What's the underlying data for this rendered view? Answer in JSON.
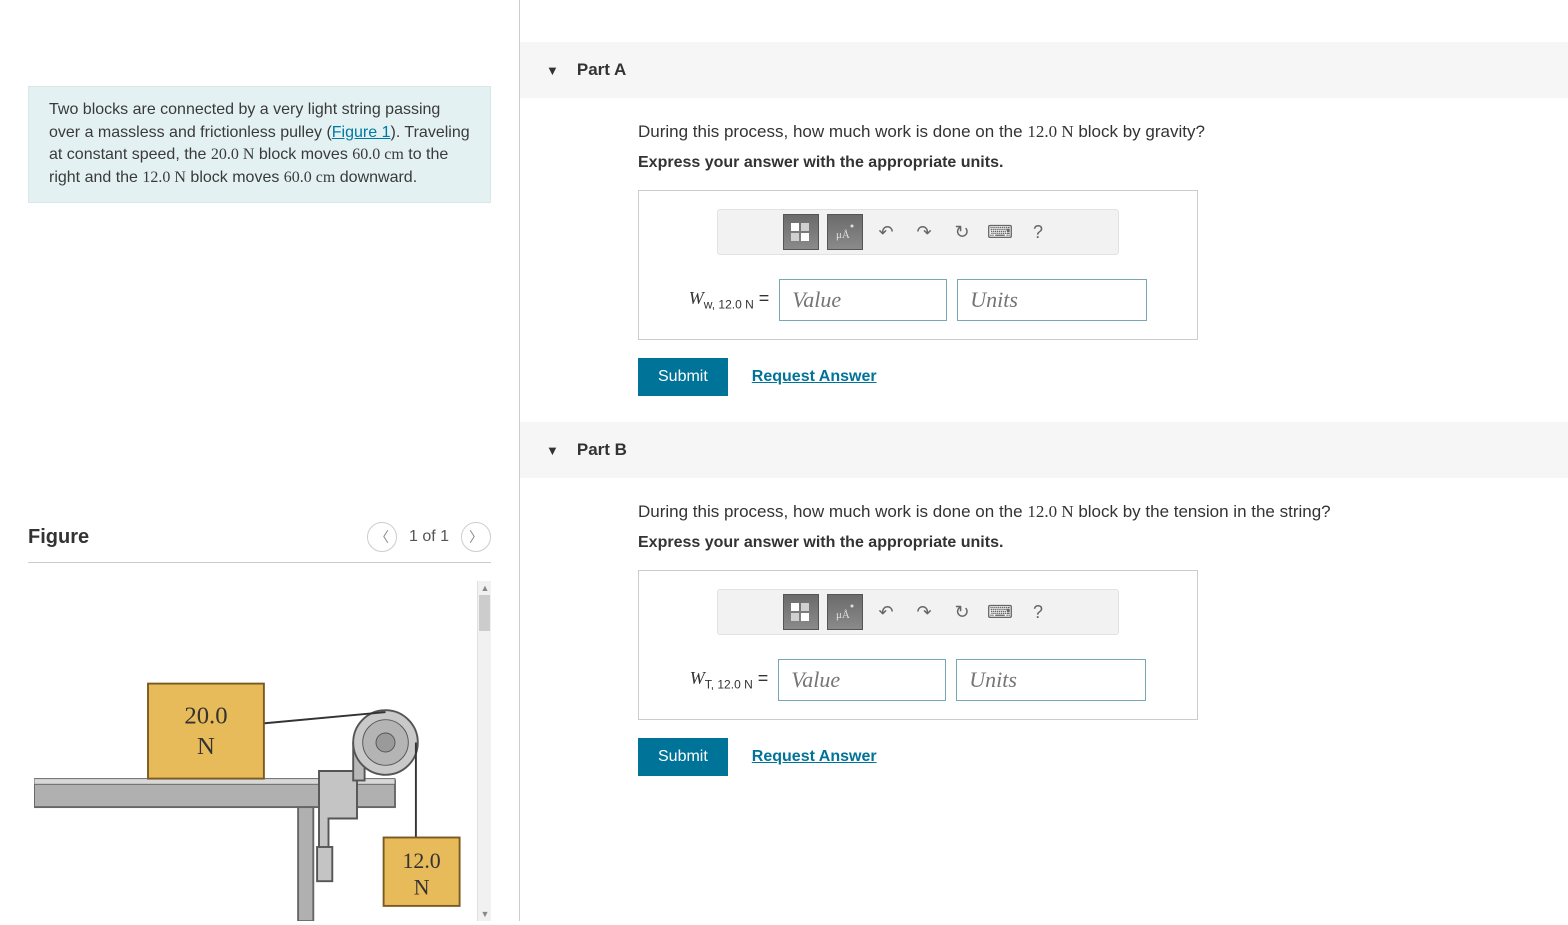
{
  "problem": {
    "text_pre": "Two blocks are connected by a very light string passing over a massless and frictionless pulley (",
    "fig_link": "Figure 1",
    "text_mid1": "). Traveling at constant speed, the ",
    "val_block1": "20.0 N",
    "text_mid2": " block moves ",
    "val_dist1": "60.0 cm",
    "text_mid3": " to the right and the ",
    "val_block2": "12.0 N",
    "text_mid4": " block moves ",
    "val_dist2": "60.0 cm",
    "text_end": " downward."
  },
  "figure": {
    "title": "Figure",
    "nav_label": "1 of 1",
    "block1_label": "20.0\nN",
    "block2_label": "12.0\nN"
  },
  "parts": {
    "a": {
      "title": "Part A",
      "question_pre": "During this process, how much work is done on the ",
      "question_val": "12.0 N",
      "question_post": " block by gravity?",
      "instruction": "Express your answer with the appropriate units.",
      "var_main": "W",
      "var_sub": "w, 12.0 N",
      "equals": " = ",
      "value_placeholder": "Value",
      "units_placeholder": "Units",
      "submit": "Submit",
      "request": "Request Answer"
    },
    "b": {
      "title": "Part B",
      "question_pre": "During this process, how much work is done on the ",
      "question_val": "12.0 N",
      "question_post": " block by the tension in the string?",
      "instruction": "Express your answer with the appropriate units.",
      "var_main": "W",
      "var_sub": "T, 12.0 N",
      "equals": " = ",
      "value_placeholder": "Value",
      "units_placeholder": "Units",
      "submit": "Submit",
      "request": "Request Answer"
    }
  },
  "icons": {
    "undo": "↶",
    "redo": "↷",
    "reset": "↻",
    "keyboard": "⌨",
    "help": "?",
    "prev": "〈",
    "next": "〉",
    "caret": "▼",
    "scroll_up": "▲",
    "scroll_down": "▼"
  }
}
